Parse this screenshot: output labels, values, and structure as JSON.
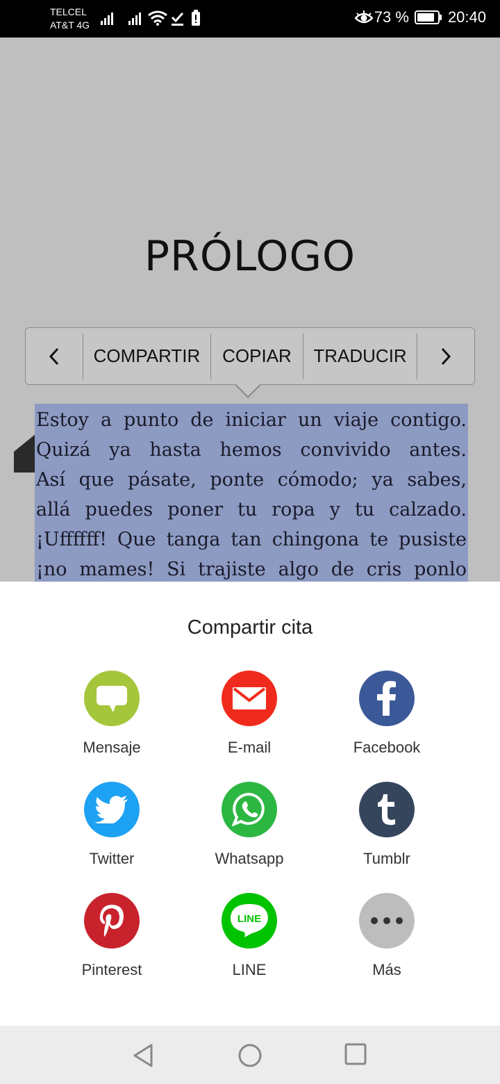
{
  "status_bar": {
    "carrier_1": "TELCEL",
    "carrier_2": "AT&T 4G",
    "battery_pct": "73 %",
    "time": "20:40"
  },
  "reader": {
    "chapter_title": "PRÓLOGO",
    "quote_lines": [
      "Estoy a punto de iniciar un viaje contigo.",
      "Quizá ya hasta hemos convivido antes.",
      "Así que pásate, ponte cómodo; ya sabes,",
      "allá puedes poner tu ropa y tu calzado.",
      "¡Uffffff! Que tanga tan chingona te pusiste",
      "¡no mames! Si trajiste algo de cris ponlo"
    ]
  },
  "selection_toolbar": {
    "share": "COMPARTIR",
    "copy": "COPIAR",
    "translate": "TRADUCIR"
  },
  "share_sheet": {
    "title": "Compartir cita",
    "options": [
      {
        "label": "Mensaje",
        "icon": "message-icon",
        "color": "#a5c63b"
      },
      {
        "label": "E-mail",
        "icon": "email-icon",
        "color": "#f02b1d"
      },
      {
        "label": "Facebook",
        "icon": "facebook-icon",
        "color": "#3b5998"
      },
      {
        "label": "Twitter",
        "icon": "twitter-icon",
        "color": "#1da1f2"
      },
      {
        "label": "Whatsapp",
        "icon": "whatsapp-icon",
        "color": "#2cb742"
      },
      {
        "label": "Tumblr",
        "icon": "tumblr-icon",
        "color": "#35465c"
      },
      {
        "label": "Pinterest",
        "icon": "pinterest-icon",
        "color": "#c8232c"
      },
      {
        "label": "LINE",
        "icon": "line-icon",
        "color": "#00c300"
      },
      {
        "label": "Más",
        "icon": "more-icon",
        "color": "#bdbdbd"
      }
    ]
  }
}
